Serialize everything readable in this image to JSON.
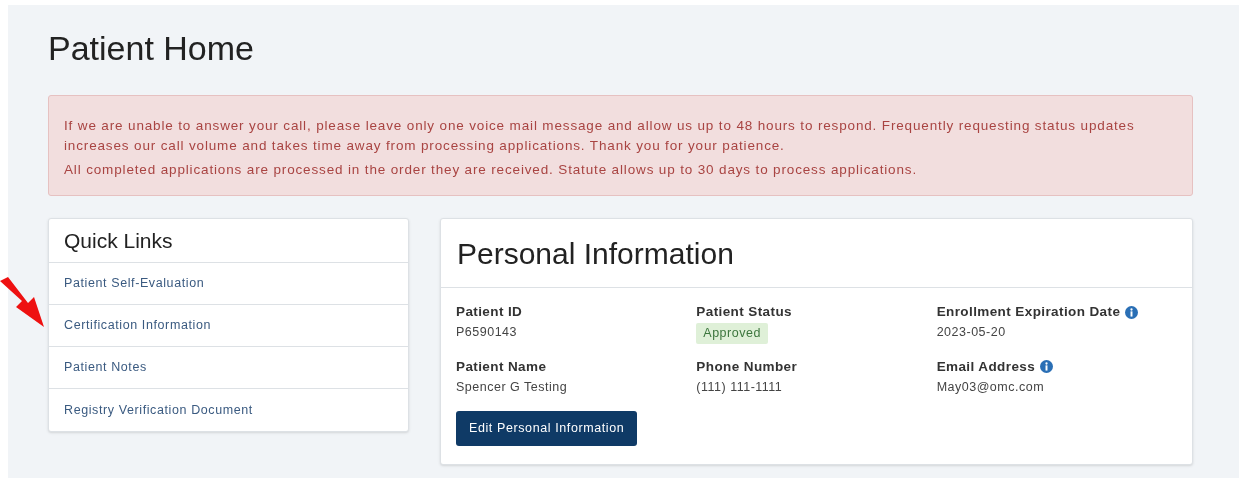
{
  "page": {
    "title": "Patient Home"
  },
  "alert": {
    "paragraphs": [
      "If we are unable to answer your call, please leave only one voice mail message and allow us up to 48 hours to respond. Frequently requesting status updates increases our call volume and takes time away from processing applications. Thank you for your patience.",
      "All completed applications are processed in the order they are received. Statute allows up to 30 days to process applications."
    ]
  },
  "quick_links": {
    "title": "Quick Links",
    "items": [
      {
        "label": "Patient Self-Evaluation"
      },
      {
        "label": "Certification Information"
      },
      {
        "label": "Patient Notes"
      },
      {
        "label": "Registry Verification Document"
      }
    ]
  },
  "personal_information": {
    "title": "Personal Information",
    "fields": [
      {
        "label": "Patient ID",
        "value": "P6590143",
        "kind": "text",
        "info": false
      },
      {
        "label": "Patient Status",
        "value": "Approved",
        "kind": "badge",
        "info": false
      },
      {
        "label": "Enrollment Expiration Date",
        "value": "2023-05-20",
        "kind": "text",
        "info": true
      },
      {
        "label": "Patient Name",
        "value": "Spencer G Testing",
        "kind": "text",
        "info": false
      },
      {
        "label": "Phone Number",
        "value": "(111) 111-1111",
        "kind": "text",
        "info": false
      },
      {
        "label": "Email Address",
        "value": "May03@omc.com",
        "kind": "text",
        "info": true
      }
    ],
    "button": "Edit Personal Information"
  }
}
